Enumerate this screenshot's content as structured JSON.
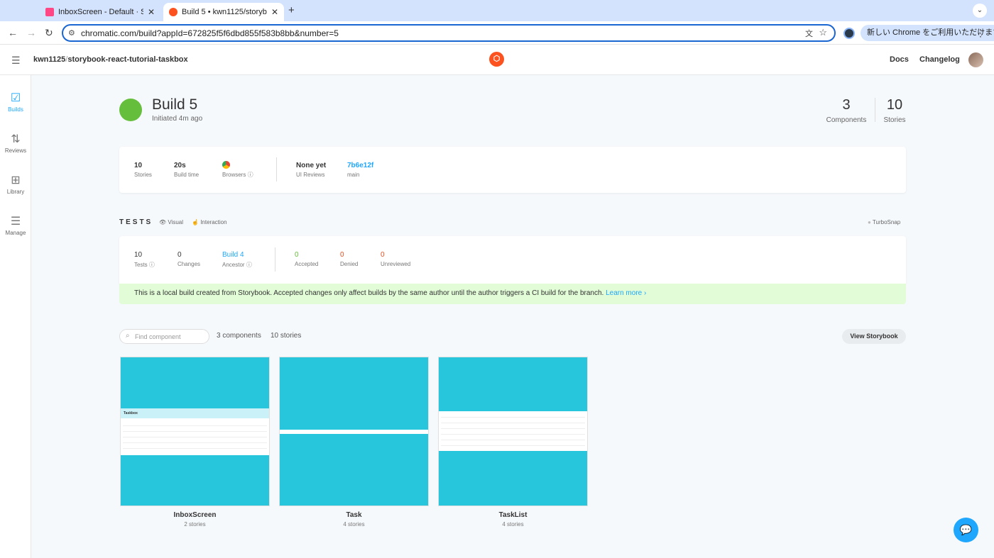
{
  "browser": {
    "tabs": [
      {
        "title": "InboxScreen - Default · Storybook",
        "active": false
      },
      {
        "title": "Build 5 • kwn1125/storybook-react-tutorial-taskbox",
        "active": true
      }
    ],
    "url": "chromatic.com/build?appId=672825f5f6dbd855f583b8bb&number=5",
    "chrome_prompt": "新しい Chrome をご利用いただけます"
  },
  "header": {
    "owner": "kwn1125",
    "separator": "/",
    "repo": "storybook-react-tutorial-taskbox",
    "docs": "Docs",
    "changelog": "Changelog"
  },
  "sidebar": {
    "items": [
      {
        "label": "Builds",
        "icon": "check-square-icon"
      },
      {
        "label": "Reviews",
        "icon": "pull-request-icon"
      },
      {
        "label": "Library",
        "icon": "grid-icon"
      },
      {
        "label": "Manage",
        "icon": "sliders-icon"
      }
    ]
  },
  "build": {
    "title": "Build 5",
    "initiated": "Initiated 4m ago",
    "status_color": "#66bf3c",
    "components_count": "3",
    "components_label": "Components",
    "stories_count": "10",
    "stories_label": "Stories"
  },
  "summary": {
    "stories": {
      "value": "10",
      "label": "Stories"
    },
    "build_time": {
      "value": "20s",
      "label": "Build time"
    },
    "browsers": {
      "label": "Browsers"
    },
    "ui_reviews": {
      "value": "None yet",
      "label": "UI Reviews"
    },
    "commit": {
      "value": "7b6e12f",
      "label": "main"
    }
  },
  "tests": {
    "title": "TESTS",
    "visual": "Visual",
    "interaction": "Interaction",
    "turbosnap": "TurboSnap",
    "tests": {
      "value": "10",
      "label": "Tests"
    },
    "changes": {
      "value": "0",
      "label": "Changes"
    },
    "ancestor": {
      "value": "Build 4",
      "label": "Ancestor"
    },
    "accepted": {
      "value": "0",
      "label": "Accepted"
    },
    "denied": {
      "value": "0",
      "label": "Denied"
    },
    "unreviewed": {
      "value": "0",
      "label": "Unreviewed"
    },
    "notice": "This is a local build created from Storybook. Accepted changes only affect builds by the same author until the author triggers a CI build for the branch.",
    "learn_more": "Learn more"
  },
  "components": {
    "search_placeholder": "Find component",
    "count_components": "3 components",
    "count_stories": "10 stories",
    "view_storybook": "View Storybook",
    "items": [
      {
        "name": "InboxScreen",
        "stories": "2 stories",
        "thumb_header": "Taskbox"
      },
      {
        "name": "Task",
        "stories": "4 stories"
      },
      {
        "name": "TaskList",
        "stories": "4 stories"
      }
    ]
  },
  "colors": {
    "accent": "#1ea7fd",
    "success": "#66bf3c",
    "thumb_bg": "#27c6dc",
    "notice_bg": "#e1fcd6",
    "brand": "#fc521f"
  }
}
